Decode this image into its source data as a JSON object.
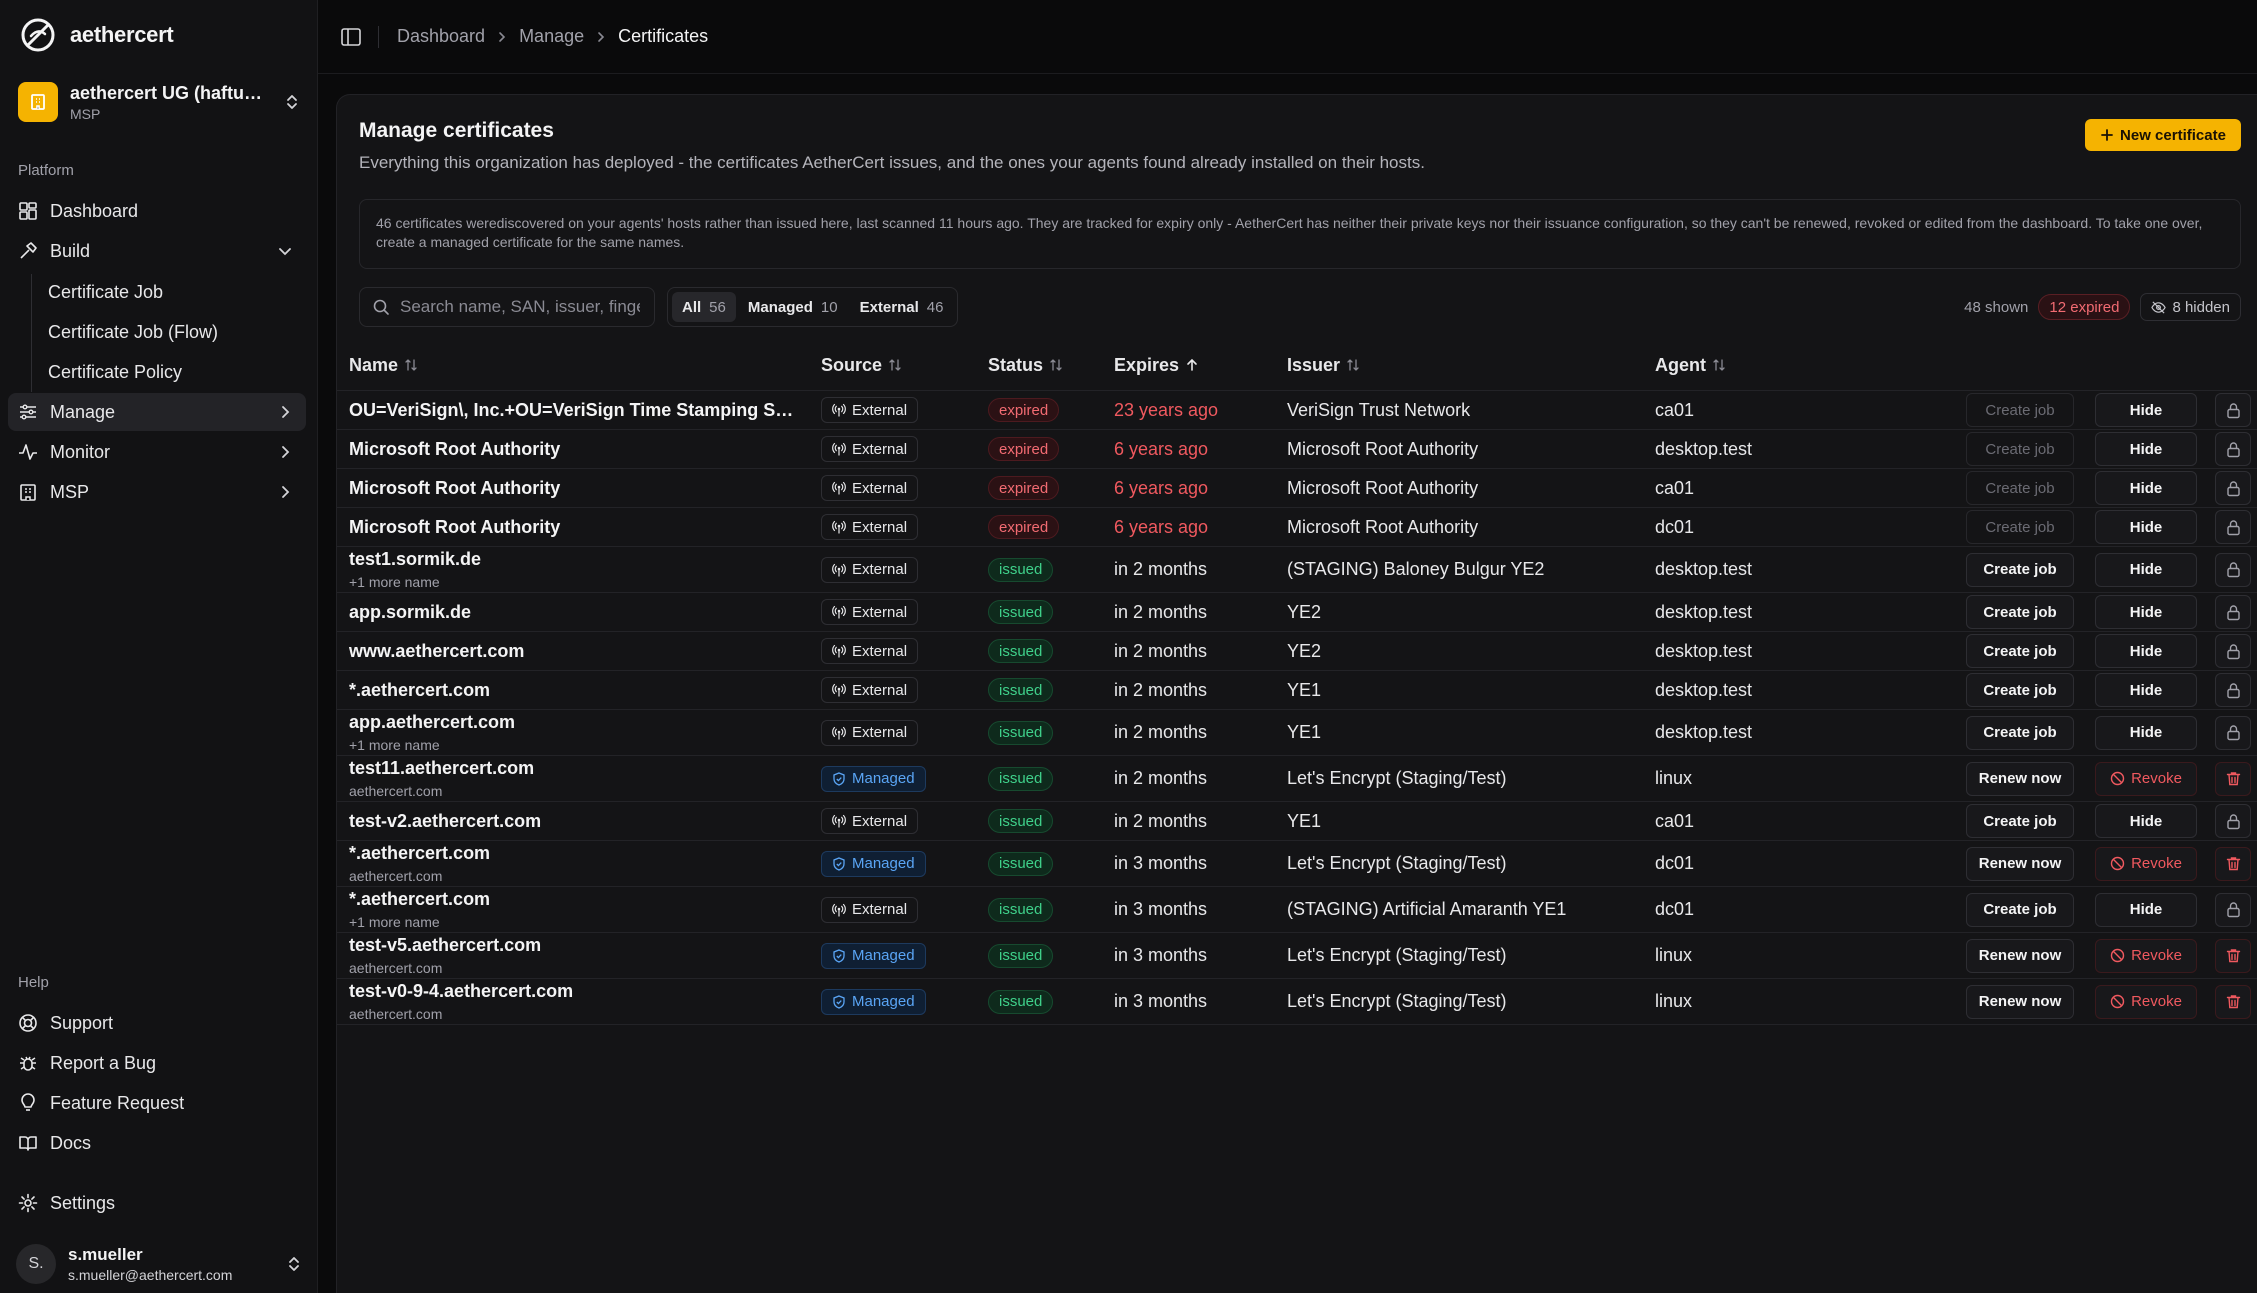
{
  "brand": {
    "name": "aethercert"
  },
  "org": {
    "name": "aethercert UG (haftung...",
    "type": "MSP"
  },
  "nav": {
    "platform_label": "Platform",
    "dashboard": "Dashboard",
    "build": "Build",
    "build_items": [
      "Certificate Job",
      "Certificate Job (Flow)",
      "Certificate Policy"
    ],
    "manage": "Manage",
    "monitor": "Monitor",
    "msp": "MSP",
    "help_label": "Help",
    "support": "Support",
    "report_bug": "Report a Bug",
    "feature_request": "Feature Request",
    "docs": "Docs",
    "settings": "Settings"
  },
  "user": {
    "initials": "S.",
    "name": "s.mueller",
    "email": "s.mueller@aethercert.com"
  },
  "breadcrumb": [
    "Dashboard",
    "Manage",
    "Certificates"
  ],
  "page": {
    "title": "Manage certificates",
    "description": "Everything this organization has deployed - the certificates AetherCert issues, and the ones your agents found already installed on their hosts.",
    "new_button": "New certificate",
    "notice": "46 certificates werediscovered on your agents' hosts rather than issued here, last scanned 11 hours ago. They are tracked for expiry only - AetherCert has neither their private keys nor their issuance configuration, so they can't be renewed, revoked or edited from the dashboard. To take one over, create a managed certificate for the same names.",
    "search_placeholder": "Search name, SAN, issuer, fingerprint",
    "filters": [
      {
        "label": "All",
        "count": "56"
      },
      {
        "label": "Managed",
        "count": "10"
      },
      {
        "label": "External",
        "count": "46"
      }
    ],
    "shown": "48 shown",
    "expired": "12 expired",
    "hidden": "8 hidden"
  },
  "table": {
    "columns": [
      "Name",
      "Source",
      "Status",
      "Expires",
      "Issuer",
      "Agent"
    ],
    "actions": {
      "create": "Create job",
      "hide": "Hide",
      "renew": "Renew now",
      "revoke": "Revoke"
    },
    "rows": [
      {
        "name": "OU=VeriSign\\, Inc.+OU=VeriSign Time Stamping Servi...",
        "sub": "",
        "source": "External",
        "status": "expired",
        "expires": "23 years ago",
        "issuer": "VeriSign Trust Network",
        "agent": "ca01"
      },
      {
        "name": "Microsoft Root Authority",
        "sub": "",
        "source": "External",
        "status": "expired",
        "expires": "6 years ago",
        "issuer": "Microsoft Root Authority",
        "agent": "desktop.test"
      },
      {
        "name": "Microsoft Root Authority",
        "sub": "",
        "source": "External",
        "status": "expired",
        "expires": "6 years ago",
        "issuer": "Microsoft Root Authority",
        "agent": "ca01"
      },
      {
        "name": "Microsoft Root Authority",
        "sub": "",
        "source": "External",
        "status": "expired",
        "expires": "6 years ago",
        "issuer": "Microsoft Root Authority",
        "agent": "dc01"
      },
      {
        "name": "test1.sormik.de",
        "sub": "+1 more name",
        "source": "External",
        "status": "issued",
        "expires": "in 2 months",
        "issuer": "(STAGING) Baloney Bulgur YE2",
        "agent": "desktop.test"
      },
      {
        "name": "app.sormik.de",
        "sub": "",
        "source": "External",
        "status": "issued",
        "expires": "in 2 months",
        "issuer": "YE2",
        "agent": "desktop.test"
      },
      {
        "name": "www.aethercert.com",
        "sub": "",
        "source": "External",
        "status": "issued",
        "expires": "in 2 months",
        "issuer": "YE2",
        "agent": "desktop.test"
      },
      {
        "name": "*.aethercert.com",
        "sub": "",
        "source": "External",
        "status": "issued",
        "expires": "in 2 months",
        "issuer": "YE1",
        "agent": "desktop.test"
      },
      {
        "name": "app.aethercert.com",
        "sub": "+1 more name",
        "source": "External",
        "status": "issued",
        "expires": "in 2 months",
        "issuer": "YE1",
        "agent": "desktop.test"
      },
      {
        "name": "test11.aethercert.com",
        "sub": "aethercert.com",
        "source": "Managed",
        "status": "issued",
        "expires": "in 2 months",
        "issuer": "Let's Encrypt (Staging/Test)",
        "agent": "linux"
      },
      {
        "name": "test-v2.aethercert.com",
        "sub": "",
        "source": "External",
        "status": "issued",
        "expires": "in 2 months",
        "issuer": "YE1",
        "agent": "ca01"
      },
      {
        "name": "*.aethercert.com",
        "sub": "aethercert.com",
        "source": "Managed",
        "status": "issued",
        "expires": "in 3 months",
        "issuer": "Let's Encrypt (Staging/Test)",
        "agent": "dc01"
      },
      {
        "name": "*.aethercert.com",
        "sub": "+1 more name",
        "source": "External",
        "status": "issued",
        "expires": "in 3 months",
        "issuer": "(STAGING) Artificial Amaranth YE1",
        "agent": "dc01"
      },
      {
        "name": "test-v5.aethercert.com",
        "sub": "aethercert.com",
        "source": "Managed",
        "status": "issued",
        "expires": "in 3 months",
        "issuer": "Let's Encrypt (Staging/Test)",
        "agent": "linux"
      },
      {
        "name": "test-v0-9-4.aethercert.com",
        "sub": "aethercert.com",
        "source": "Managed",
        "status": "issued",
        "expires": "in 3 months",
        "issuer": "Let's Encrypt (Staging/Test)",
        "agent": "linux"
      }
    ]
  },
  "colors": {
    "accent": "#f5b301",
    "expired": "#f0595f",
    "issued": "#3fd08a",
    "managed": "#5aa5f5"
  }
}
